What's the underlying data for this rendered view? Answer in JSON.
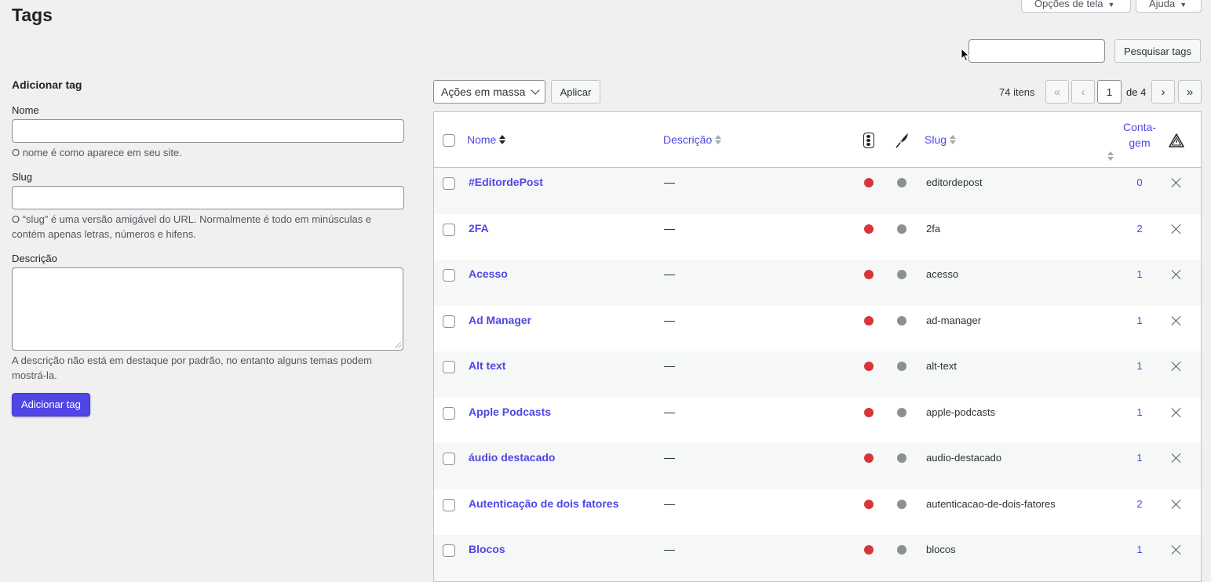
{
  "header": {
    "title": "Tags",
    "screen_options_label": "Opções de tela",
    "help_label": "Ajuda"
  },
  "search": {
    "value": "",
    "button_label": "Pesquisar tags"
  },
  "add_form": {
    "heading": "Adicionar tag",
    "name_label": "Nome",
    "name_value": "",
    "name_help": "O nome é como aparece em seu site.",
    "slug_label": "Slug",
    "slug_value": "",
    "slug_help": "O “slug” é uma versão amigável do URL. Normalmente é todo em minúsculas e contém apenas letras, números e hifens.",
    "description_label": "Descrição",
    "description_value": "",
    "description_help": "A descrição não está em destaque por padrão, no entanto alguns temas podem mostrá-la.",
    "submit_label": "Adicionar tag"
  },
  "tablenav": {
    "bulk_actions_label": "Ações em massa",
    "apply_label": "Aplicar",
    "items_count": "74 itens",
    "first_label": "«",
    "prev_label": "‹",
    "current_page": "1",
    "of_label": "de 4",
    "next_label": "›",
    "last_label": "»"
  },
  "table": {
    "columns": {
      "name": "Nome",
      "description": "Descrição",
      "slug": "Slug",
      "count_line1": "Conta-",
      "count_line2": "gem"
    },
    "column_icons": [
      "traffic-light-icon",
      "feather-icon",
      "warning-icon"
    ],
    "colors": {
      "link": "#4f46e5",
      "status_red": "#d63638",
      "status_grey": "#8c8f94"
    },
    "rows": [
      {
        "name": "#EditordePost",
        "description": "—",
        "slug": "editordepost",
        "count": "0"
      },
      {
        "name": "2FA",
        "description": "—",
        "slug": "2fa",
        "count": "2"
      },
      {
        "name": "Acesso",
        "description": "—",
        "slug": "acesso",
        "count": "1"
      },
      {
        "name": "Ad Manager",
        "description": "—",
        "slug": "ad-manager",
        "count": "1"
      },
      {
        "name": "Alt text",
        "description": "—",
        "slug": "alt-text",
        "count": "1"
      },
      {
        "name": "Apple Podcasts",
        "description": "—",
        "slug": "apple-podcasts",
        "count": "1"
      },
      {
        "name": "áudio destacado",
        "description": "—",
        "slug": "audio-destacado",
        "count": "1"
      },
      {
        "name": "Autenticação de dois fatores",
        "description": "—",
        "slug": "autenticacao-de-dois-fatores",
        "count": "2"
      },
      {
        "name": "Blocos",
        "description": "—",
        "slug": "blocos",
        "count": "1"
      }
    ]
  }
}
